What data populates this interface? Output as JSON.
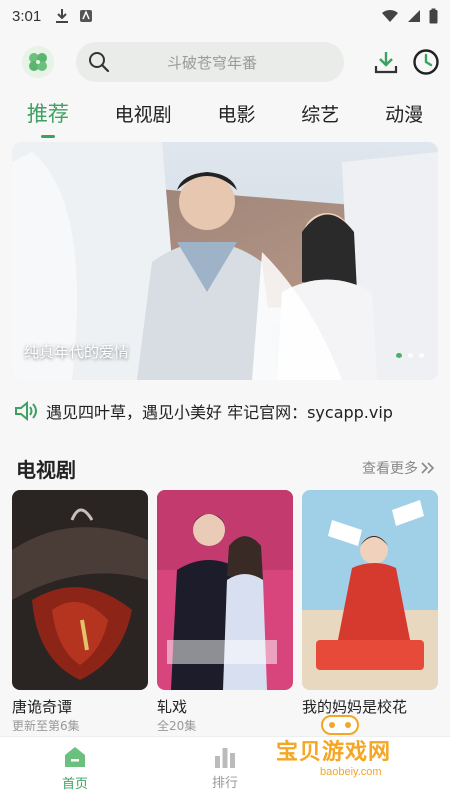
{
  "status_bar": {
    "time": "3:01"
  },
  "header": {
    "search_placeholder": "斗破苍穹年番"
  },
  "tabs": [
    {
      "label": "推荐",
      "active": true
    },
    {
      "label": "电视剧"
    },
    {
      "label": "电影"
    },
    {
      "label": "综艺"
    },
    {
      "label": "动漫"
    }
  ],
  "banner": {
    "caption": "纯真年代的爱情",
    "slide_count": 3,
    "active_slide": 1
  },
  "notice": {
    "text": "遇见四叶草，遇见小美好 牢记官网：sycapp.vip"
  },
  "section": {
    "title": "电视剧",
    "more_label": "查看更多",
    "items": [
      {
        "title": "唐诡奇谭",
        "subtitle": "更新至第6集"
      },
      {
        "title": "轧戏",
        "subtitle": "全20集"
      },
      {
        "title": "我的妈妈是校花",
        "subtitle": ""
      }
    ]
  },
  "bottom_nav": [
    {
      "label": "首页",
      "active": true
    },
    {
      "label": "排行"
    },
    {
      "label": ""
    }
  ],
  "watermark": {
    "text": "宝贝游戏网",
    "url": "baobeiy.com"
  },
  "colors": {
    "accent": "#3ea163",
    "background": "#f6f7f6"
  }
}
